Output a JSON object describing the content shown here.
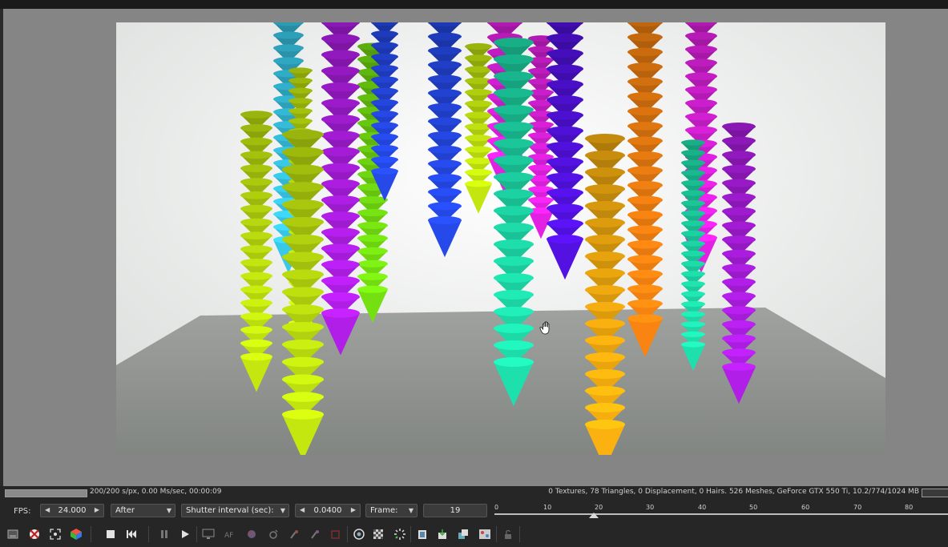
{
  "colors": {
    "background": "#858585",
    "panel": "#262626",
    "cyan": "#35b9d6",
    "purple": "#a41cd6",
    "blue": "#2344d8",
    "teal": "#1ccfa0",
    "magenta": "#d21fd2",
    "indigo": "#4d10d2",
    "orange": "#e67a10",
    "amber": "#e8a40e",
    "lime": "#b6d60e",
    "green": "#6ccf10"
  },
  "render_status": {
    "progress": 1.0,
    "text": "200/200 s/px, 0.00 Ms/sec, 00:00:09",
    "stats": "0 Textures, 78 Triangles, 0 Displacement, 0 Hairs. 526 Meshes, GeForce GTX 550 Ti, 10.2/774/1024 MB"
  },
  "controls": {
    "fps_label": "FPS:",
    "fps_value": "24.000",
    "motion_mode": "After",
    "shutter_label": "Shutter interval (sec):",
    "shutter_value": "0.0400",
    "frame_label": "Frame:",
    "frame_value": "19"
  },
  "timeline": {
    "ticks": [
      "0",
      "10",
      "20",
      "30",
      "40",
      "50",
      "60",
      "70",
      "80"
    ],
    "current_frame": 19
  },
  "toolbar": {
    "icons": [
      "save-image-icon",
      "clear-cache-icon",
      "fit-view-icon",
      "color-cube-icon",
      "stop-icon",
      "rewind-icon",
      "pause-icon",
      "play-icon",
      "display-icon",
      "af-icon",
      "color-wheel-icon",
      "material-picker-icon",
      "focus-picker-icon",
      "camera-picker-icon",
      "region-icon",
      "lock-camera-icon",
      "alpha-checker-icon",
      "spinner-icon",
      "clipboard-icon",
      "export-icon",
      "layers-icon",
      "settings-icon",
      "lock-icon"
    ]
  }
}
